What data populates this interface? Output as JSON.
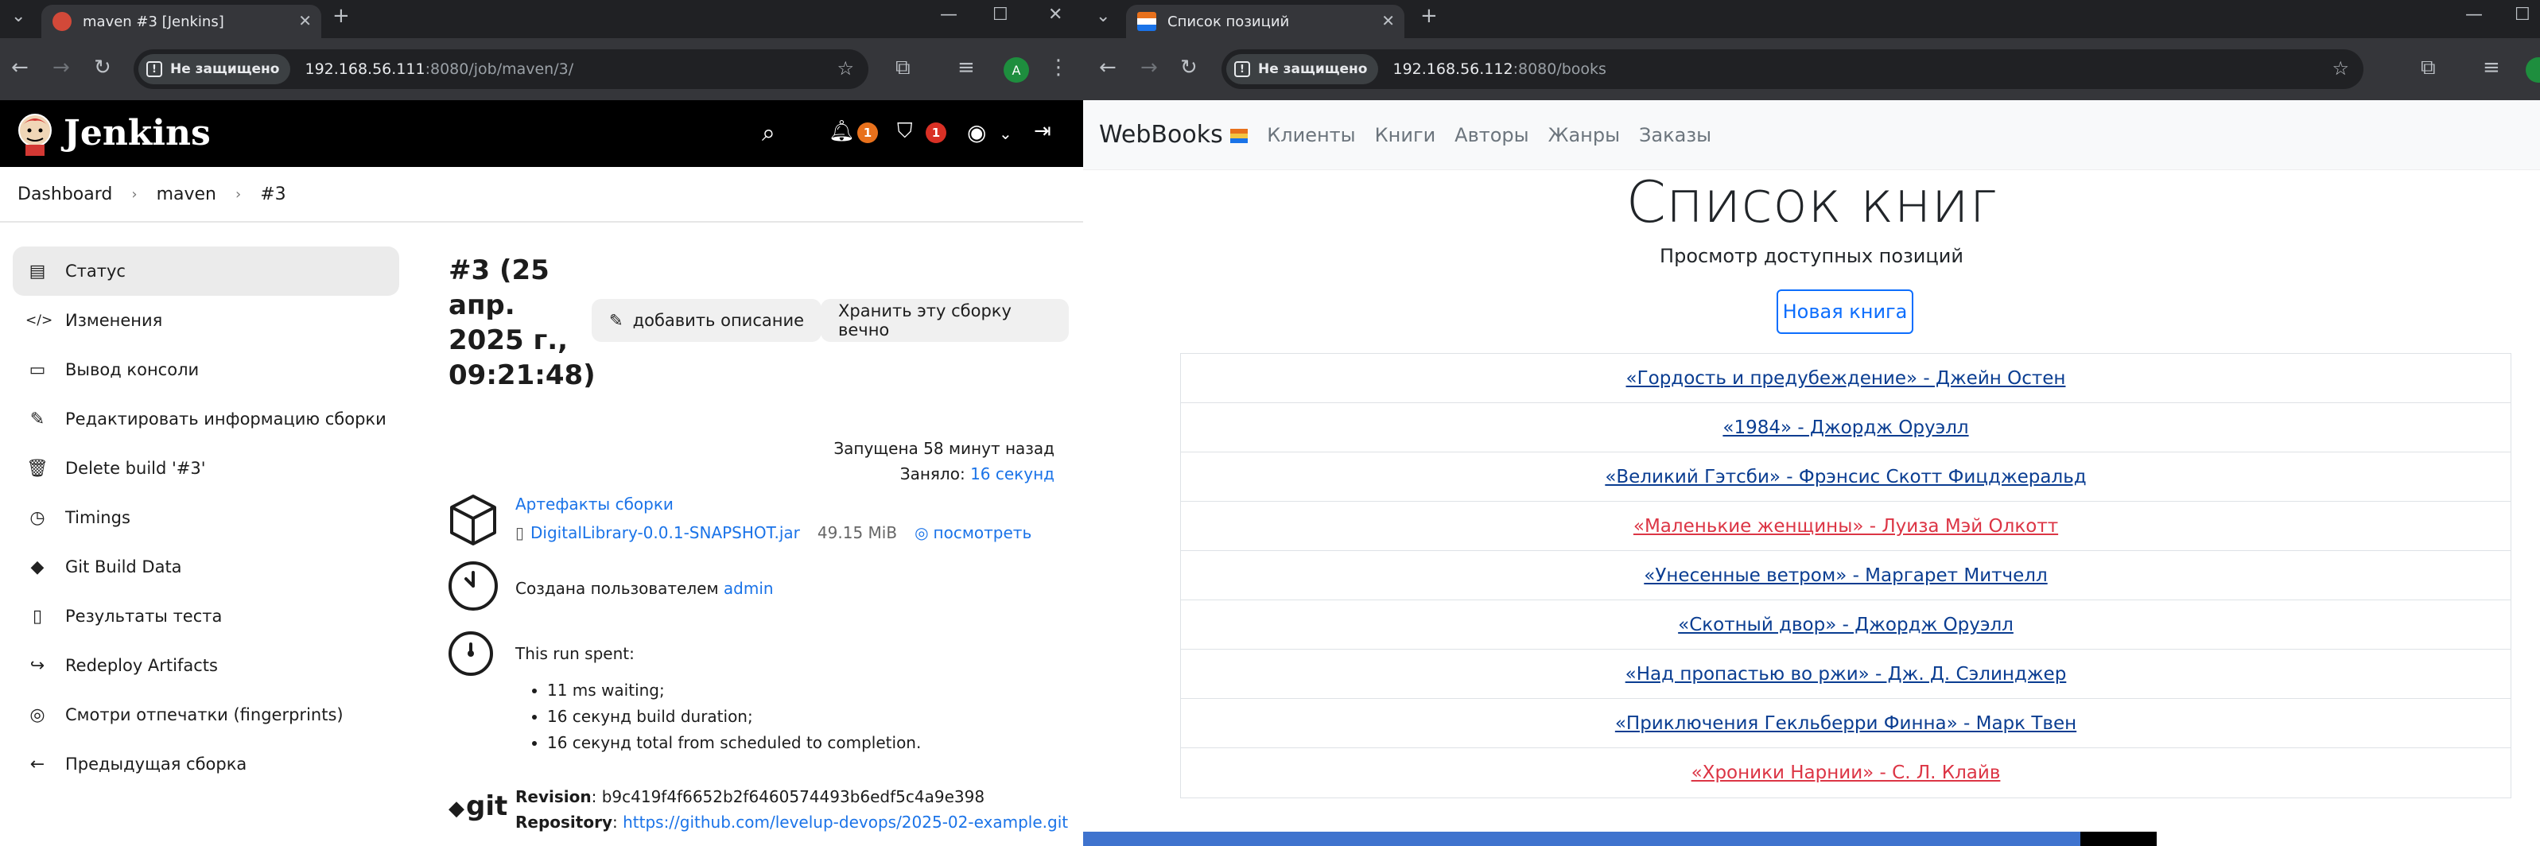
{
  "left_browser": {
    "tab_title": "maven #3 [Jenkins]",
    "not_secure": "Не защищено",
    "url_host": "192.168.56.111",
    "url_rest": ":8080/job/maven/3/",
    "profile_initial": "A"
  },
  "right_browser": {
    "tab_title": "Список позиций",
    "not_secure": "Не защищено",
    "url_host": "192.168.56.112",
    "url_rest": ":8080/books"
  },
  "jenkins": {
    "brand": "Jenkins",
    "notifications_count": "1",
    "security_count": "1",
    "breadcrumbs": [
      "Dashboard",
      "maven",
      "#3"
    ],
    "sidebar": [
      {
        "label": "Статус",
        "icon": "status-icon",
        "glyph": "▤"
      },
      {
        "label": "Изменения",
        "icon": "code-icon",
        "glyph": "</>"
      },
      {
        "label": "Вывод консоли",
        "icon": "terminal-icon",
        "glyph": "▭"
      },
      {
        "label": "Редактировать информацию сборки",
        "icon": "edit-icon",
        "glyph": "✎"
      },
      {
        "label": "Delete build '#3'",
        "icon": "trash-icon",
        "glyph": "🗑"
      },
      {
        "label": "Timings",
        "icon": "clock-icon",
        "glyph": "◷"
      },
      {
        "label": "Git Build Data",
        "icon": "git-icon",
        "glyph": "◆"
      },
      {
        "label": "Результаты теста",
        "icon": "clipboard-icon",
        "glyph": "▯"
      },
      {
        "label": "Redeploy Artifacts",
        "icon": "redeploy-icon",
        "glyph": "↪"
      },
      {
        "label": "Смотри отпечатки (fingerprints)",
        "icon": "fingerprint-icon",
        "glyph": "◎"
      },
      {
        "label": "Предыдущая сборка",
        "icon": "arrow-left-icon",
        "glyph": "←"
      }
    ],
    "build_title": "#3 (25 апр. 2025 г., 09:21:48)",
    "add_description": "добавить описание",
    "keep_forever": "Хранить эту сборку вечно",
    "started": "Запущена 58 минут назад",
    "took_label": "Заняло: ",
    "took_value": "16 секунд",
    "artifacts_title": "Артефакты сборки",
    "artifact_file": "DigitalLibrary-0.0.1-SNAPSHOT.jar",
    "artifact_size": "49.15 MiB",
    "artifact_view": "посмотреть",
    "created_by_label": "Создана пользователем ",
    "created_by_user": "admin",
    "run_spent": "This run spent:",
    "run_items": [
      "11 ms waiting;",
      "16 секунд build duration;",
      "16 секунд total from scheduled to completion."
    ],
    "revision_label": "Revision",
    "revision_value": ": b9c419f4f6652b2f6460574493b6edf5c4a9e398",
    "repository_label": "Repository",
    "repository_value": "https://github.com/levelup-devops/2025-02-example.git",
    "git_logo_text": "git"
  },
  "webbooks": {
    "brand": "WebBooks",
    "nav": [
      "Клиенты",
      "Книги",
      "Авторы",
      "Жанры",
      "Заказы"
    ],
    "heading": "Список книг",
    "lead": "Просмотр доступных позиций",
    "new_book": "Новая книга",
    "books": [
      {
        "text": "«Гордость и предубеждение» - Джейн Остен",
        "status": "normal"
      },
      {
        "text": "«1984» - Джордж Оруэлл",
        "status": "normal"
      },
      {
        "text": "«Великий Гэтсби» - Фрэнсис Скотт Фицджеральд",
        "status": "normal"
      },
      {
        "text": "«Маленькие женщины» - Луиза Мэй Олкотт",
        "status": "highlighted"
      },
      {
        "text": "«Унесенные ветром» - Маргарет Митчелл",
        "status": "normal"
      },
      {
        "text": "«Скотный двор» - Джордж Оруэлл",
        "status": "normal"
      },
      {
        "text": "«Над пропастью во ржи» - Дж. Д. Сэлинджер",
        "status": "normal"
      },
      {
        "text": "«Приключения Гекльберри Финна» - Марк Твен",
        "status": "normal"
      },
      {
        "text": "«Хроники Нарнии» - С. Л. Клайв",
        "status": "highlighted"
      }
    ]
  },
  "colors": {
    "link": "#1a73e8",
    "highlight_red": "#dc3545",
    "book_link": "#0a3d91",
    "badge_orange": "#e8711c",
    "badge_red": "#d93025"
  }
}
